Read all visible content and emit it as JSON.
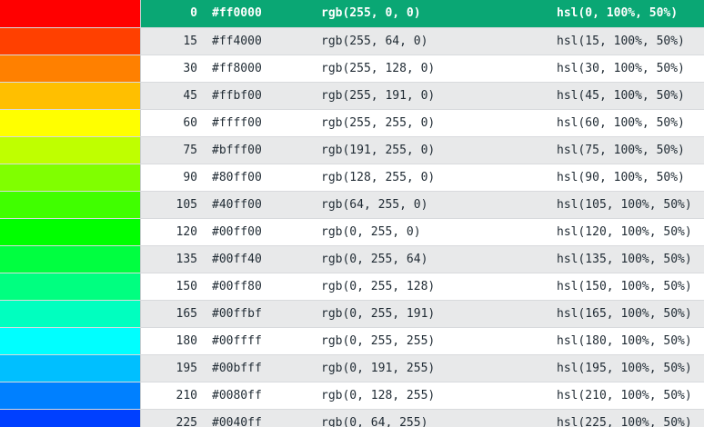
{
  "colors": {
    "selected_row_bg": "#0aa774",
    "even_row_bg": "#e8e9ea",
    "odd_row_bg": "#ffffff"
  },
  "selected_index": 0,
  "rows": [
    {
      "hue": "0",
      "hex": "#ff0000",
      "rgb": "rgb(255, 0, 0)",
      "hsl": "hsl(0, 100%, 50%)"
    },
    {
      "hue": "15",
      "hex": "#ff4000",
      "rgb": "rgb(255, 64, 0)",
      "hsl": "hsl(15, 100%, 50%)"
    },
    {
      "hue": "30",
      "hex": "#ff8000",
      "rgb": "rgb(255, 128, 0)",
      "hsl": "hsl(30, 100%, 50%)"
    },
    {
      "hue": "45",
      "hex": "#ffbf00",
      "rgb": "rgb(255, 191, 0)",
      "hsl": "hsl(45, 100%, 50%)"
    },
    {
      "hue": "60",
      "hex": "#ffff00",
      "rgb": "rgb(255, 255, 0)",
      "hsl": "hsl(60, 100%, 50%)"
    },
    {
      "hue": "75",
      "hex": "#bfff00",
      "rgb": "rgb(191, 255, 0)",
      "hsl": "hsl(75, 100%, 50%)"
    },
    {
      "hue": "90",
      "hex": "#80ff00",
      "rgb": "rgb(128, 255, 0)",
      "hsl": "hsl(90, 100%, 50%)"
    },
    {
      "hue": "105",
      "hex": "#40ff00",
      "rgb": "rgb(64, 255, 0)",
      "hsl": "hsl(105, 100%, 50%)"
    },
    {
      "hue": "120",
      "hex": "#00ff00",
      "rgb": "rgb(0, 255, 0)",
      "hsl": "hsl(120, 100%, 50%)"
    },
    {
      "hue": "135",
      "hex": "#00ff40",
      "rgb": "rgb(0, 255, 64)",
      "hsl": "hsl(135, 100%, 50%)"
    },
    {
      "hue": "150",
      "hex": "#00ff80",
      "rgb": "rgb(0, 255, 128)",
      "hsl": "hsl(150, 100%, 50%)"
    },
    {
      "hue": "165",
      "hex": "#00ffbf",
      "rgb": "rgb(0, 255, 191)",
      "hsl": "hsl(165, 100%, 50%)"
    },
    {
      "hue": "180",
      "hex": "#00ffff",
      "rgb": "rgb(0, 255, 255)",
      "hsl": "hsl(180, 100%, 50%)"
    },
    {
      "hue": "195",
      "hex": "#00bfff",
      "rgb": "rgb(0, 191, 255)",
      "hsl": "hsl(195, 100%, 50%)"
    },
    {
      "hue": "210",
      "hex": "#0080ff",
      "rgb": "rgb(0, 128, 255)",
      "hsl": "hsl(210, 100%, 50%)"
    },
    {
      "hue": "225",
      "hex": "#0040ff",
      "rgb": "rgb(0, 64, 255)",
      "hsl": "hsl(225, 100%, 50%)"
    }
  ]
}
